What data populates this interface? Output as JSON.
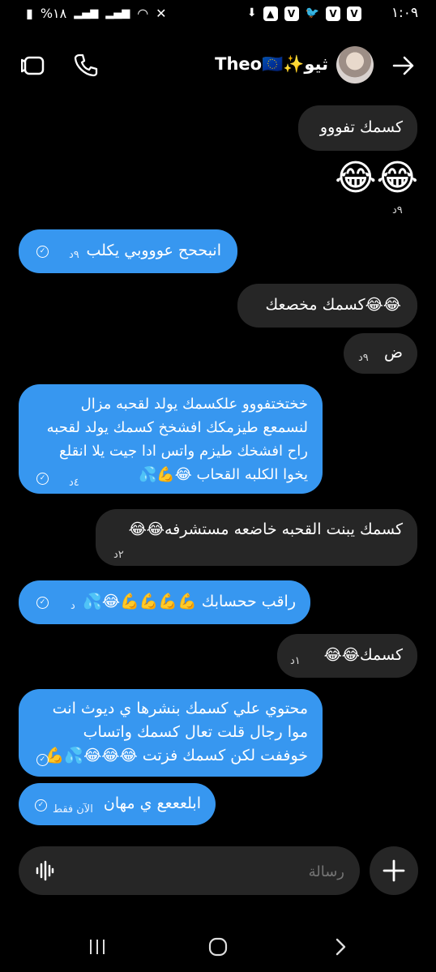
{
  "status_bar": {
    "time": "١:٠٩",
    "battery": "%١٨"
  },
  "header": {
    "contact_name": "Theo🇪🇺✨ثيو"
  },
  "messages": [
    {
      "side": "in",
      "text": "كسمك تفووو"
    },
    {
      "side": "in",
      "text": "😂😂",
      "time": "٩د"
    },
    {
      "side": "out",
      "text": "انبححح عوووبي يكلب",
      "time": "٩د"
    },
    {
      "side": "in",
      "text": "😂😂كسمك مخصعك"
    },
    {
      "side": "in",
      "text": "ض",
      "time": "٩د"
    },
    {
      "side": "out",
      "text": "خختختفووو علكسمك يولد لقحبه مزال لنسمعع طيزمكك افشخخ كسمك يولد لقحبه راح افشخك طيزم واتس ادا جيت يلا انقلع يخوا الكلبه القحاب 😂💪💦",
      "time": "٤د"
    },
    {
      "side": "in",
      "text": "كسمك يبنت القحبه خاضعه مستشرفه😂😂",
      "time": "٢د"
    },
    {
      "side": "out",
      "text": "راقب ححسابك 💪💪💪💪😂💦",
      "time": "د"
    },
    {
      "side": "in",
      "text": "كسمك😂😂",
      "time": "١د"
    },
    {
      "side": "out",
      "text": "محتوي علي كسمك بنشرها ي ديوث انت موا رجال قلت تعال كسمك واتساب خوففت لكن كسمك فزتت 😂😂😂💦💪"
    },
    {
      "side": "out",
      "text": "ابلعععع ي مهان",
      "time": "الآن فقط"
    }
  ],
  "composer": {
    "placeholder": "رسالة"
  },
  "colors": {
    "outgoing": "#3797f0",
    "incoming": "#262626",
    "background": "#000000"
  }
}
